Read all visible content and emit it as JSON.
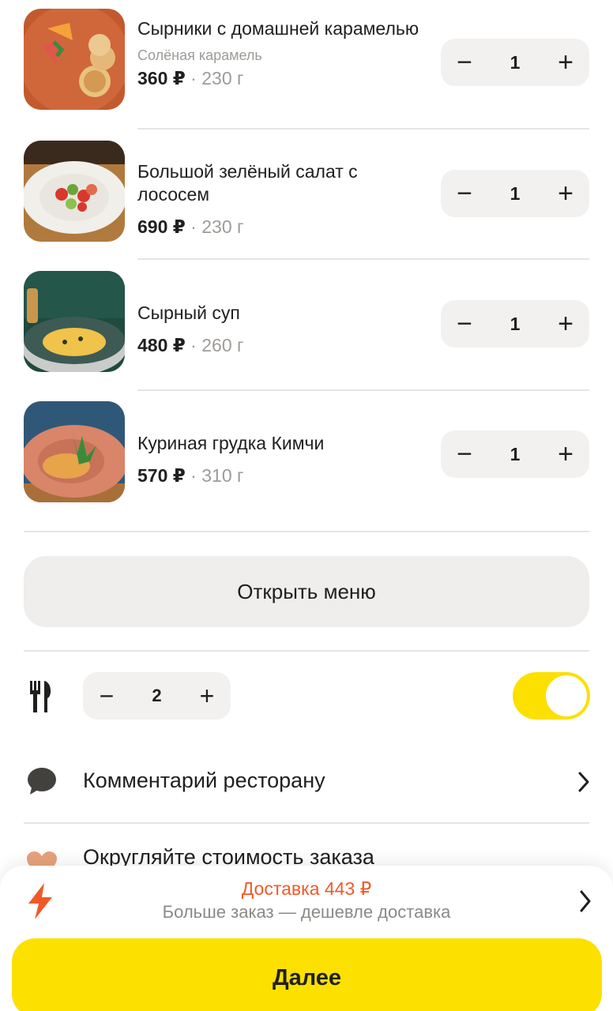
{
  "cart": {
    "items": [
      {
        "name": "Сырники с домашней карамелью",
        "modifier": "Солёная карамель",
        "price": "360 ₽",
        "weight": "230 г",
        "quantity": "1",
        "image": "syrniki-photo"
      },
      {
        "name": "Большой зелёный салат с лососем",
        "price": "690 ₽",
        "weight": "230 г",
        "quantity": "1",
        "image": "salad-photo"
      },
      {
        "name": "Сырный суп",
        "price": "480 ₽",
        "weight": "260 г",
        "quantity": "1",
        "image": "soup-photo"
      },
      {
        "name": "Куриная грудка Кимчи",
        "price": "570 ₽",
        "weight": "310 г",
        "quantity": "1",
        "image": "chicken-photo"
      }
    ],
    "separator": " · ",
    "minus_symbol": "−",
    "plus_symbol": "+"
  },
  "open_menu_label": "Открыть меню",
  "cutlery": {
    "icon": "cutlery-icon",
    "quantity": "2",
    "enabled": true
  },
  "comment_row": {
    "label": "Комментарий ресторану",
    "icon": "comment-bubble-icon"
  },
  "round_row": {
    "label": "Округляйте стоимость заказа",
    "icon": "heart-icon"
  },
  "delivery": {
    "title": "Доставка 443 ₽",
    "subtitle": "Больше заказ — дешевле доставка",
    "icon": "lightning-icon"
  },
  "next_button_label": "Далее",
  "colors": {
    "accent": "#fce000",
    "delivery": "#f05a28",
    "text": "#21201f",
    "muted": "#9e9b98",
    "control_bg": "#f2f1f0"
  }
}
